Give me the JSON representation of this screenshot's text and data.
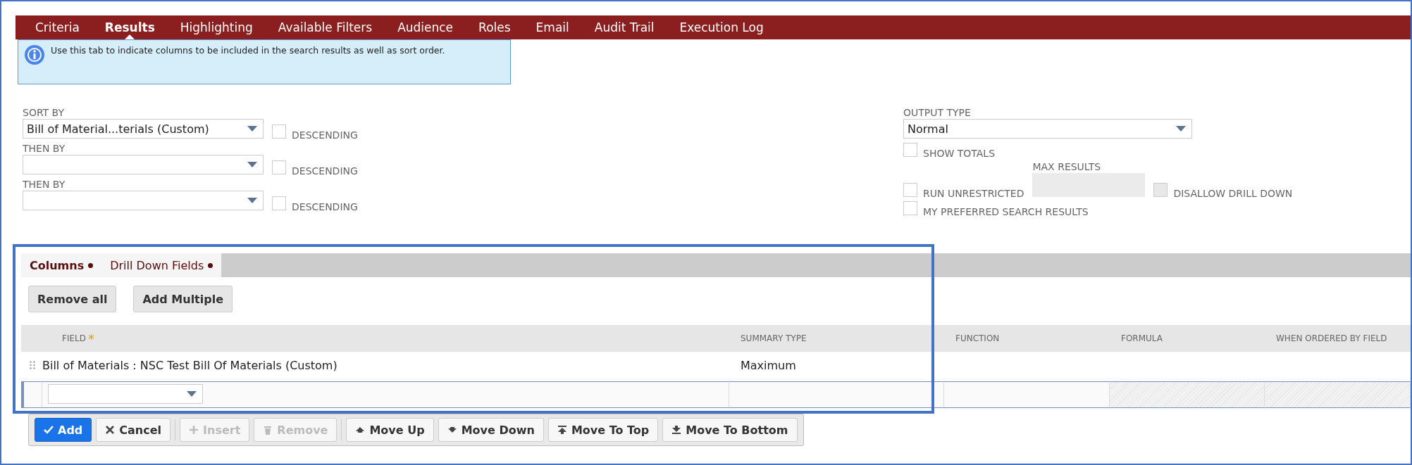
{
  "tabs": [
    {
      "label": "Criteria",
      "selected": false
    },
    {
      "label": "Results",
      "selected": true
    },
    {
      "label": "Highlighting",
      "selected": false
    },
    {
      "label": "Available Filters",
      "selected": false
    },
    {
      "label": "Audience",
      "selected": false
    },
    {
      "label": "Roles",
      "selected": false
    },
    {
      "label": "Email",
      "selected": false
    },
    {
      "label": "Audit Trail",
      "selected": false
    },
    {
      "label": "Execution Log",
      "selected": false
    }
  ],
  "info": "Use this tab to indicate columns to be included in the search results as well as sort order.",
  "sort_rows": [
    {
      "label": "SORT BY",
      "value": "Bill of Material...terials (Custom)",
      "descending": {
        "label": "DESCENDING",
        "checked": false
      }
    },
    {
      "label": "THEN BY",
      "value": "",
      "descending": {
        "label": "DESCENDING",
        "checked": false
      }
    },
    {
      "label": "THEN BY",
      "value": "",
      "descending": {
        "label": "DESCENDING",
        "checked": false
      }
    }
  ],
  "output": {
    "label": "OUTPUT TYPE",
    "value": "Normal",
    "show_totals": {
      "label": "SHOW TOTALS",
      "checked": false
    },
    "max_results_label": "MAX RESULTS",
    "run_unrestricted": {
      "label": "RUN UNRESTRICTED",
      "checked": false
    },
    "disallow_drill_down": {
      "label": "DISALLOW DRILL DOWN",
      "checked": false,
      "disabled": true
    },
    "preferred": {
      "label": "MY PREFERRED SEARCH RESULTS",
      "checked": false
    }
  },
  "subtabs": [
    {
      "label": "Columns",
      "selected": true
    },
    {
      "label": "Drill Down Fields",
      "selected": false
    }
  ],
  "list_buttons": [
    "Remove all",
    "Add Multiple"
  ],
  "table": {
    "columns": [
      {
        "label": "FIELD",
        "mark": "*"
      },
      {
        "label": "SUMMARY TYPE"
      },
      {
        "label": "FUNCTION"
      },
      {
        "label": "FORMULA"
      },
      {
        "label": "WHEN ORDERED BY FIELD"
      }
    ],
    "rows": [
      [
        "Bill of Materials : NSC Test Bill Of Materials (Custom)",
        "Maximum",
        "",
        "",
        ""
      ]
    ]
  },
  "actions": [
    {
      "label": "Add",
      "kind": "check",
      "primary": true,
      "disabled": false
    },
    {
      "label": "Cancel",
      "kind": "cross",
      "primary": false,
      "disabled": false
    },
    {
      "label": "Insert",
      "kind": "plus",
      "primary": false,
      "disabled": true
    },
    {
      "label": "Remove",
      "kind": "trash",
      "primary": false,
      "disabled": true
    },
    {
      "label": "Move Up",
      "kind": "up",
      "primary": false,
      "disabled": false
    },
    {
      "label": "Move Down",
      "kind": "down",
      "primary": false,
      "disabled": false
    },
    {
      "label": "Move To Top",
      "kind": "top",
      "primary": false,
      "disabled": false
    },
    {
      "label": "Move To Bottom",
      "kind": "bottom",
      "primary": false,
      "disabled": false
    }
  ]
}
